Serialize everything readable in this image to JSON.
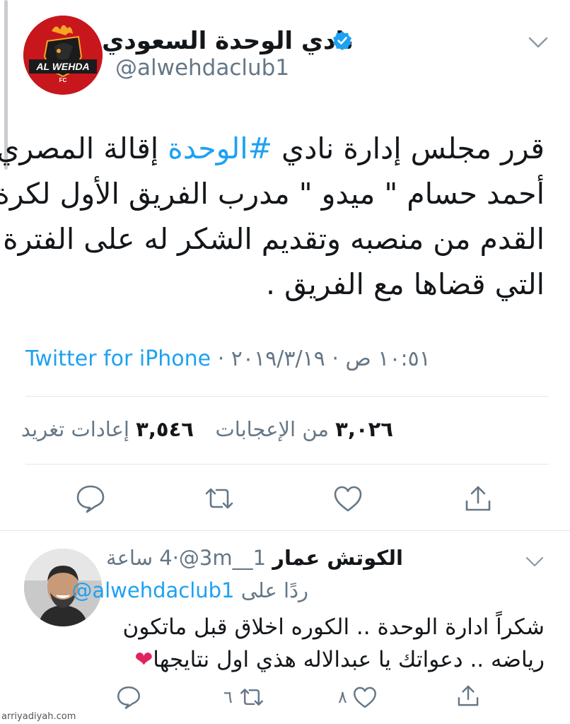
{
  "tweet": {
    "display_name": "نادي الوحدة السعودي",
    "handle": "@alwehdaclub1",
    "avatar_logo_text": "AL WEHDA",
    "avatar_logo_sub": "FC",
    "text_lines": [
      {
        "before": "قرر مجلس إدارة نادي ",
        "hashtag": "#الوحدة",
        "after": " إقالة المصري"
      },
      {
        "before": "أحمد حسام \" ميدو \" مدرب الفريق الأول لكرة",
        "hashtag": "",
        "after": ""
      },
      {
        "before": "القدم من منصبه وتقديم الشكر له على الفترة",
        "hashtag": "",
        "after": ""
      },
      {
        "before": "التي قضاها مع الفريق .",
        "hashtag": "",
        "after": ""
      }
    ],
    "time": "١٠:٥١ ص",
    "separator": "·",
    "date": "٢٠١٩/٣/١٩",
    "client": "Twitter for iPhone",
    "retweets_count": "٣,٥٤٦",
    "retweets_label": "إعادات تغريد",
    "likes_count": "٣,٠٢٦",
    "likes_label": "من الإعجابات",
    "accent_color": "#1da1f2",
    "verified": true
  },
  "reply": {
    "name": "الكوتش عمار",
    "handle": "@3m__1",
    "separator": "·",
    "time": "4 ساعة",
    "reply_prefix": "ردًا على",
    "reply_to_handle": "@alwehdaclub1",
    "text_lines": [
      "شكراً ادارة الوحدة .. الكوره اخلاق قبل ماتكون",
      "رياضه .. دعواتك يا عبدالاله هذي اول نتايجها"
    ],
    "emoji": "❤",
    "retweet_count": "٦",
    "like_count": "٨"
  },
  "watermark": "arriyadiyah.com"
}
